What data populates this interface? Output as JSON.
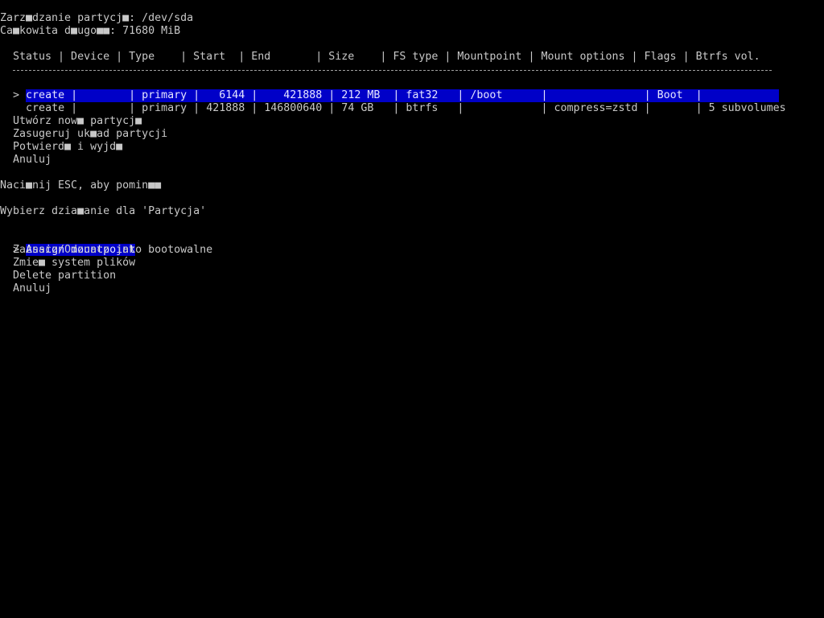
{
  "header": {
    "title": "Zarz■dzanie partycj■: /dev/sda",
    "total_length": "Ca■kowita d■ugo■■: 71680 MiB"
  },
  "table": {
    "header_row": "  Status | Device | Type    | Start  | End       | Size    | FS type | Mountpoint | Mount options | Flags | Btrfs vol.",
    "rows": [
      {
        "pointer": ">",
        "text": "create |        | primary |   6144 |    421888 | 212 MB  | fat32   | /boot      |               | Boot  |             "
      },
      {
        "pointer": " ",
        "text": "create |        | primary | 421888 | 146800640 | 74 GB   | btrfs   |            | compress=zstd |       | 5 subvolumes"
      }
    ]
  },
  "partition_menu": [
    "Utwórz now■ partycj■",
    "Zasugeruj uk■ad partycji",
    "Potwierd■ i wyjd■",
    "Anuluj"
  ],
  "hint": "Naci■nij ESC, aby pomin■■",
  "action_prompt": "Wybierz dzia■anie dla 'Partycja'",
  "action_menu": {
    "pointer": ">",
    "items": [
      "Assign mountpoint",
      "Zaznacz/Odznacz jako bootowalne",
      "Zmie■ system plików",
      "Delete partition",
      "Anuluj"
    ]
  },
  "colors": {
    "background": "#000000",
    "text": "#c8c8c8",
    "highlight": "#0000c8"
  }
}
